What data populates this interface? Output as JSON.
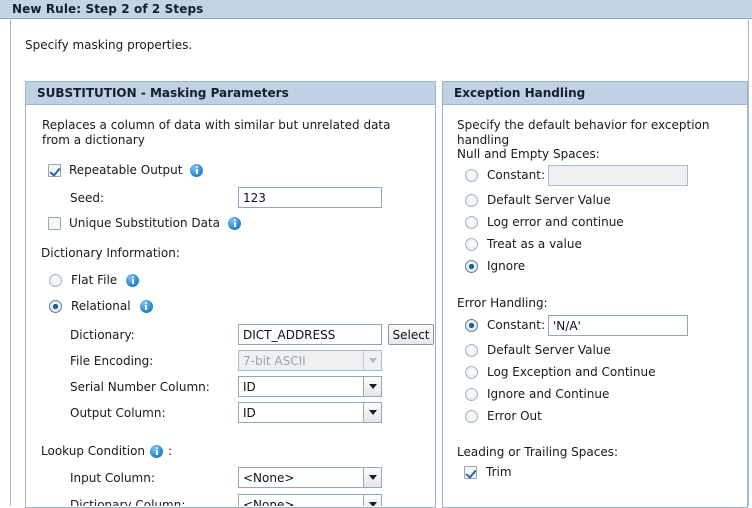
{
  "window": {
    "title": "New Rule: Step 2 of 2 Steps"
  },
  "intro": "Specify masking properties.",
  "left_panel": {
    "header": "SUBSTITUTION - Masking Parameters",
    "description": "Replaces a column of data with similar but unrelated data from a dictionary",
    "repeatable_output": {
      "label": "Repeatable Output",
      "checked": true
    },
    "seed": {
      "label": "Seed:",
      "value": "123"
    },
    "unique_substitution": {
      "label": "Unique Substitution Data",
      "checked": false
    },
    "dictionary_information_label": "Dictionary Information:",
    "flat_file": {
      "label": "Flat File",
      "selected": false
    },
    "relational": {
      "label": "Relational",
      "selected": true
    },
    "dictionary": {
      "label": "Dictionary:",
      "value": "DICT_ADDRESS",
      "button": "Select"
    },
    "file_encoding": {
      "label": "File Encoding:",
      "value": "7-bit ASCII",
      "disabled": true
    },
    "serial_number_column": {
      "label": "Serial Number Column:",
      "value": "ID"
    },
    "output_column": {
      "label": "Output Column:",
      "value": "ID"
    },
    "lookup_condition_label": "Lookup Condition",
    "lookup_condition_colon": ":",
    "input_column": {
      "label": "Input Column:",
      "value": "<None>"
    },
    "dictionary_column": {
      "label": "Dictionary Column:",
      "value": "<None>"
    }
  },
  "right_panel": {
    "header": "Exception Handling",
    "description": "Specify the default behavior for exception handling",
    "null_and_empty_label": "Null and Empty Spaces:",
    "null_options": [
      {
        "label": "Constant:",
        "selected": false,
        "has_input": true,
        "input_value": "",
        "input_disabled": true
      },
      {
        "label": "Default Server Value",
        "selected": false
      },
      {
        "label": "Log error and continue",
        "selected": false
      },
      {
        "label": "Treat as a value",
        "selected": false
      },
      {
        "label": "Ignore",
        "selected": true
      }
    ],
    "error_handling_label": "Error Handling:",
    "error_options": [
      {
        "label": "Constant:",
        "selected": true,
        "has_input": true,
        "input_value": "'N/A'",
        "input_disabled": false
      },
      {
        "label": "Default Server Value",
        "selected": false
      },
      {
        "label": "Log Exception and Continue",
        "selected": false
      },
      {
        "label": "Ignore and Continue",
        "selected": false
      },
      {
        "label": "Error Out",
        "selected": false
      }
    ],
    "spaces_label": "Leading or Trailing Spaces:",
    "trim": {
      "label": "Trim",
      "checked": true
    }
  },
  "colors": {
    "titlebar": "#c3d4e4",
    "panel_header": "#bfd1e2",
    "panel_border": "#9db5cc",
    "accent_radio": "#1570b8",
    "info_icon": "#2e90d8"
  }
}
